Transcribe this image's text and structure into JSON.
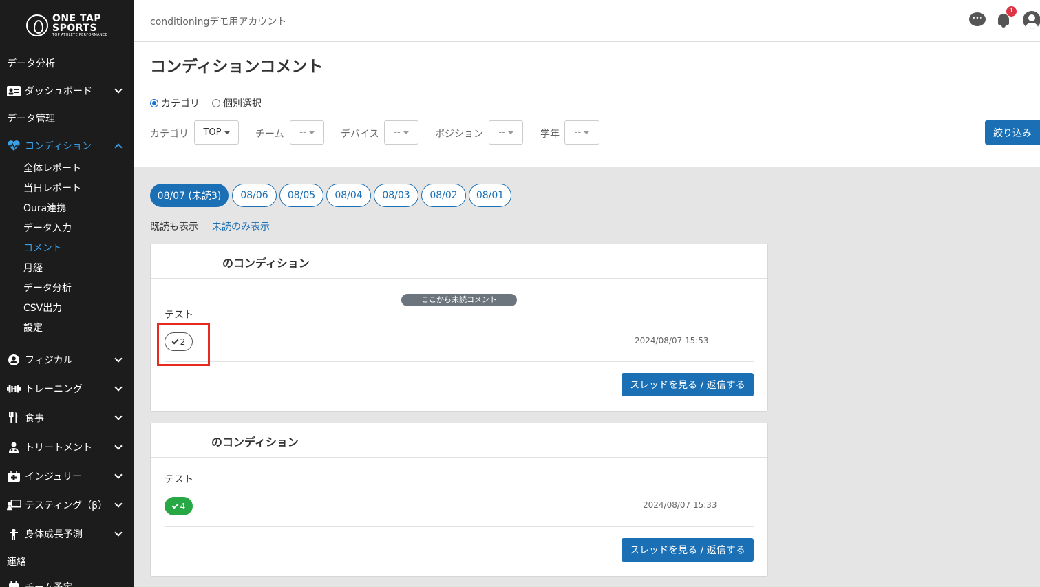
{
  "brand": {
    "line1": "ONE TAP",
    "line2": "SPORTS",
    "tagline": "TOP ATHLETE PERFORMANCE"
  },
  "sidebar": {
    "items": [
      {
        "label": "データ分析",
        "icon": ""
      },
      {
        "label": "ダッシュボード",
        "icon": "id-card-icon"
      },
      {
        "label": "データ管理",
        "icon": ""
      },
      {
        "label": "コンディション",
        "icon": "heartbeat-icon"
      },
      {
        "label": "フィジカル",
        "icon": "user-circle-icon"
      },
      {
        "label": "トレーニング",
        "icon": "dumbbell-icon"
      },
      {
        "label": "食事",
        "icon": "utensils-icon"
      },
      {
        "label": "トリートメント",
        "icon": "user-md-icon"
      },
      {
        "label": "インジュリー",
        "icon": "first-aid-icon"
      },
      {
        "label": "テスティング（β）",
        "icon": "chalkboard-teacher-icon"
      },
      {
        "label": "身体成長予測",
        "icon": "child-growth-icon"
      },
      {
        "label": "連絡",
        "icon": ""
      },
      {
        "label": "チーム予定",
        "icon": "calendar-icon"
      }
    ],
    "condition_sub": [
      "全体レポート",
      "当日レポート",
      "Oura連携",
      "データ入力",
      "コメント",
      "月経",
      "データ分析",
      "CSV出力",
      "設定"
    ]
  },
  "header": {
    "account": "conditioningデモ用アカウント",
    "notification_count": "1"
  },
  "page": {
    "title": "コンディションコメント",
    "radio": {
      "category": "カテゴリ",
      "individual": "個別選択"
    },
    "filters": {
      "category_label": "カテゴリ",
      "category_value": "TOP",
      "team_label": "チーム",
      "team_value": "--",
      "device_label": "デバイス",
      "device_value": "--",
      "position_label": "ポジション",
      "position_value": "--",
      "grade_label": "学年",
      "grade_value": "--",
      "submit": "絞り込み"
    },
    "dates": [
      "08/07 (未読3)",
      "08/06",
      "08/05",
      "08/04",
      "08/03",
      "08/02",
      "08/01"
    ],
    "read_filter": {
      "show_all": "既読も表示",
      "unread_only": "未読のみ表示"
    }
  },
  "cards": [
    {
      "title": "のコンディション",
      "separator": "ここから未読コメント",
      "comment": "テスト",
      "check_count": "2",
      "timestamp": "2024/08/07 15:53",
      "button": "スレッドを見る / 返信する"
    },
    {
      "title": "のコンディション",
      "comment": "テスト",
      "check_count": "4",
      "timestamp": "2024/08/07 15:33",
      "button": "スレッドを見る / 返信する"
    }
  ],
  "colors": {
    "primary": "#1a6fb5",
    "active_nav": "#3aa0e8",
    "sidebar_bg": "#1c1c1c",
    "check_green": "#28a745",
    "highlight": "#e8291f"
  }
}
